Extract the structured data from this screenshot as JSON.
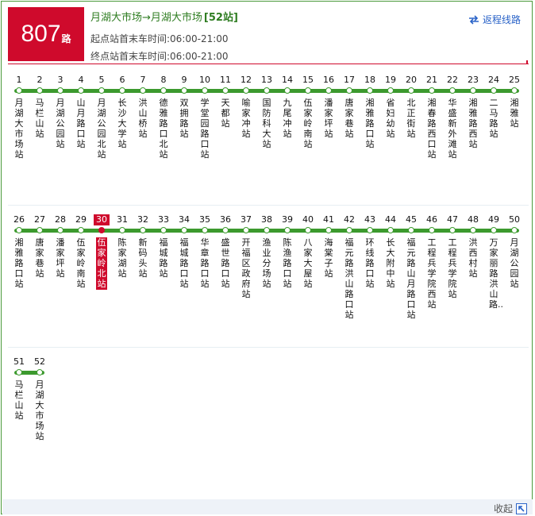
{
  "route": {
    "number": "807",
    "suffix": "路"
  },
  "header": {
    "title": "月湖大市场→月湖大市场",
    "stop_count": "[52站]",
    "start_time": "起点站首末车时间:06:00-21:00",
    "end_time": "终点站首末车时间:06:00-21:00",
    "return_label": "返程线路"
  },
  "footer": {
    "collapse_label": "收起"
  },
  "colors": {
    "line": "#3c9a2e",
    "active": "#cf0a2c",
    "link": "#2a63c8"
  },
  "active_stop": "30",
  "stops": [
    {
      "n": "1",
      "name": "月湖大市场站"
    },
    {
      "n": "2",
      "name": "马栏山站"
    },
    {
      "n": "3",
      "name": "月湖公园站"
    },
    {
      "n": "4",
      "name": "山月路口站"
    },
    {
      "n": "5",
      "name": "月湖公园北站"
    },
    {
      "n": "6",
      "name": "长沙大学站"
    },
    {
      "n": "7",
      "name": "洪山桥站"
    },
    {
      "n": "8",
      "name": "德雅路口北站"
    },
    {
      "n": "9",
      "name": "双拥路站"
    },
    {
      "n": "10",
      "name": "学堂园路口站"
    },
    {
      "n": "11",
      "name": "天都站"
    },
    {
      "n": "12",
      "name": "喻家冲站"
    },
    {
      "n": "13",
      "name": "国防科大站"
    },
    {
      "n": "14",
      "name": "九尾冲站"
    },
    {
      "n": "15",
      "name": "伍家岭南站"
    },
    {
      "n": "16",
      "name": "潘家坪站"
    },
    {
      "n": "17",
      "name": "唐家巷站"
    },
    {
      "n": "18",
      "name": "湘雅路口站"
    },
    {
      "n": "19",
      "name": "省妇幼站"
    },
    {
      "n": "20",
      "name": "北正街站"
    },
    {
      "n": "21",
      "name": "湘春路西口站"
    },
    {
      "n": "22",
      "name": "华盛新外滩站"
    },
    {
      "n": "23",
      "name": "湘雅路西站"
    },
    {
      "n": "24",
      "name": "二马路站"
    },
    {
      "n": "25",
      "name": "湘雅站"
    },
    {
      "n": "26",
      "name": "湘雅路口站"
    },
    {
      "n": "27",
      "name": "唐家巷站"
    },
    {
      "n": "28",
      "name": "潘家坪站"
    },
    {
      "n": "29",
      "name": "伍家岭南站"
    },
    {
      "n": "30",
      "name": "伍家岭北站"
    },
    {
      "n": "31",
      "name": "陈家湖站"
    },
    {
      "n": "32",
      "name": "新码头站"
    },
    {
      "n": "33",
      "name": "福城路站"
    },
    {
      "n": "34",
      "name": "福城路口站"
    },
    {
      "n": "35",
      "name": "华章路口站"
    },
    {
      "n": "36",
      "name": "盛世路口站"
    },
    {
      "n": "37",
      "name": "开福区政府站"
    },
    {
      "n": "38",
      "name": "渔业分场站"
    },
    {
      "n": "39",
      "name": "陈渔路口站"
    },
    {
      "n": "40",
      "name": "八家大屋站"
    },
    {
      "n": "41",
      "name": "海棠子站"
    },
    {
      "n": "42",
      "name": "福元路洪山路口站"
    },
    {
      "n": "43",
      "name": "环线路口站"
    },
    {
      "n": "44",
      "name": "长大附中站"
    },
    {
      "n": "45",
      "name": "福元路山月路口站"
    },
    {
      "n": "46",
      "name": "工程兵学院西站"
    },
    {
      "n": "47",
      "name": "工程兵学院站"
    },
    {
      "n": "48",
      "name": "洪西村站"
    },
    {
      "n": "49",
      "name": "万家丽路洪山路.."
    },
    {
      "n": "50",
      "name": "月湖公园站"
    },
    {
      "n": "51",
      "name": "马栏山站"
    },
    {
      "n": "52",
      "name": "月湖大市场站"
    }
  ]
}
